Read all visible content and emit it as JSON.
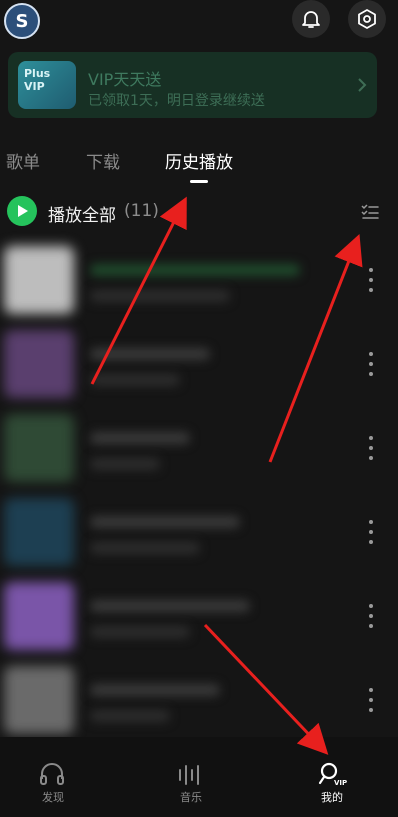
{
  "header": {
    "avatar_letter": "S",
    "bell_icon": "bell-icon",
    "settings_icon": "gear-icon"
  },
  "vip_banner": {
    "card_text": "Plus VIP",
    "title": "VIP天天送",
    "subtitle": "已领取1天，明日登录继续送"
  },
  "tabs": [
    {
      "label": "歌单",
      "active": false
    },
    {
      "label": "下载",
      "active": false
    },
    {
      "label": "历史播放",
      "active": true
    }
  ],
  "play_all": {
    "label": "播放全部",
    "count": "(11)"
  },
  "bottom_nav": [
    {
      "label": "发现",
      "icon": "headphones-icon",
      "active": false
    },
    {
      "label": "音乐",
      "icon": "equalizer-icon",
      "active": false
    },
    {
      "label": "我的",
      "icon": "profile-vip-icon",
      "active": true,
      "badge": "VIP"
    }
  ],
  "colors": {
    "background": "#151515",
    "accent_green": "#25c35c",
    "annotation_red": "#e8201e"
  }
}
